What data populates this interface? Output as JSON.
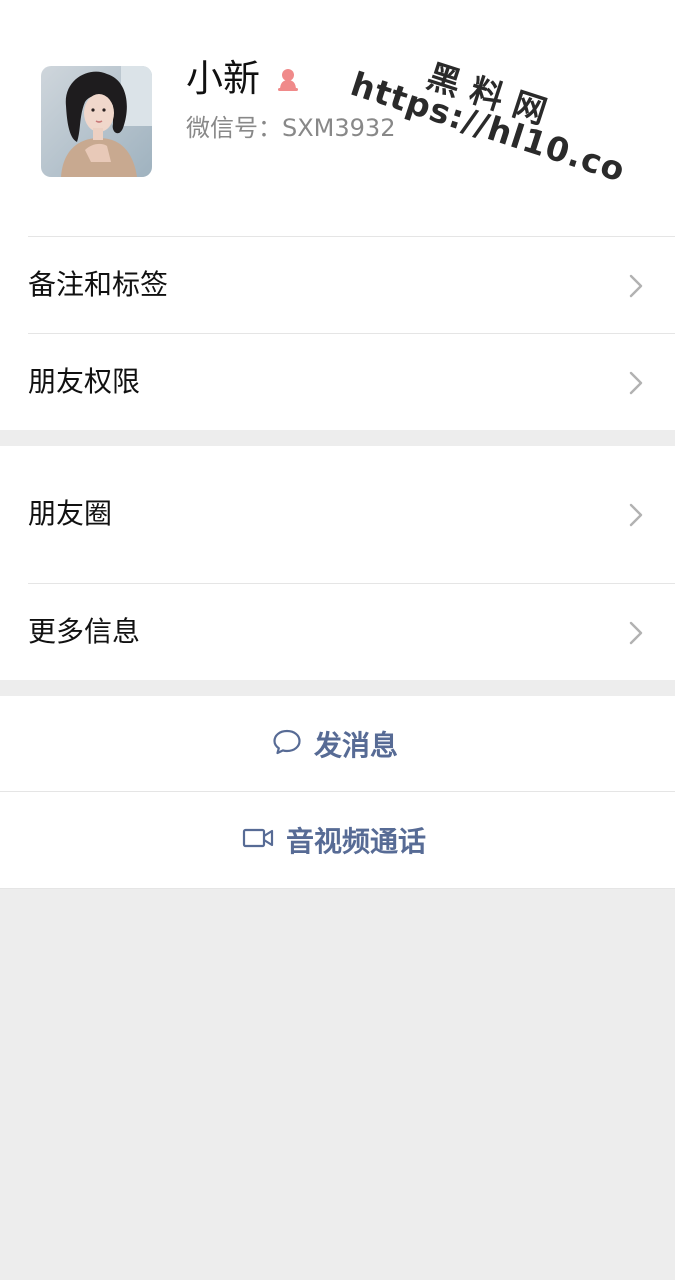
{
  "profile": {
    "name": "小新",
    "wechat_id": "微信号：SXM3932",
    "gender_icon": "female-icon",
    "avatar": "avatar"
  },
  "watermark": {
    "line1": "黑料网",
    "line2": "https://hl10.co"
  },
  "menu_group1": [
    {
      "label": "备注和标签",
      "icon": "chevron-right-icon"
    },
    {
      "label": "朋友权限",
      "icon": "chevron-right-icon"
    }
  ],
  "menu_group2": [
    {
      "label": "朋友圈",
      "icon": "chevron-right-icon"
    },
    {
      "label": "更多信息",
      "icon": "chevron-right-icon"
    }
  ],
  "actions": {
    "send_message": {
      "label": "发消息",
      "icon": "chat-bubble-icon"
    },
    "av_call": {
      "label": "音视频通话",
      "icon": "video-camera-icon"
    }
  },
  "colors": {
    "action_blue": "#576b95",
    "background": "#ededed",
    "gender_female": "#f08a8a"
  }
}
